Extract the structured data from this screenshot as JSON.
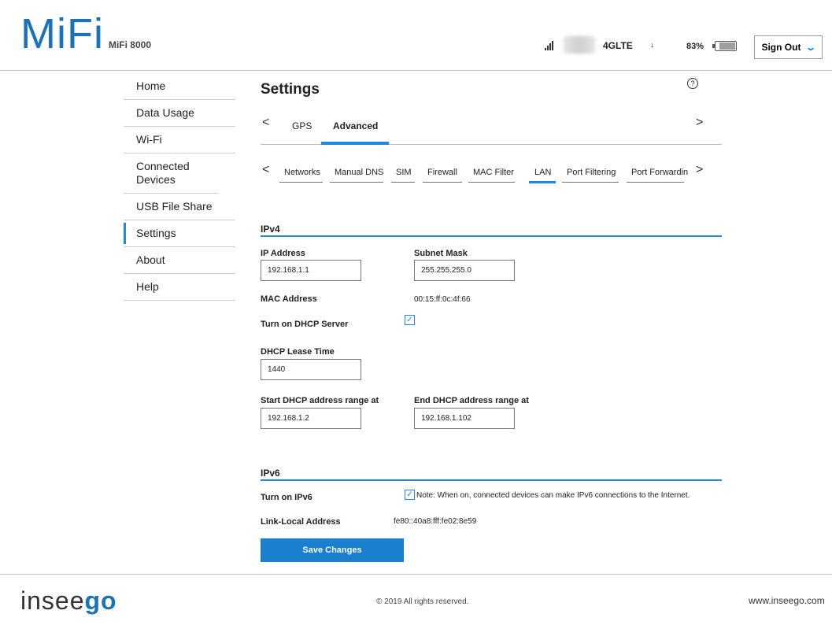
{
  "header": {
    "logo": "MiFi",
    "model": "MiFi 8000",
    "network": "4GLTE",
    "data_arrow": "↓",
    "battery_pct": "83%",
    "battery_level": 0.83,
    "sign_out": "Sign Out"
  },
  "sidebar": {
    "items": [
      {
        "label": "Home"
      },
      {
        "label": "Data Usage"
      },
      {
        "label": "Wi-Fi"
      },
      {
        "label": "Connected Devices"
      },
      {
        "label": "USB File Share"
      },
      {
        "label": "Settings"
      },
      {
        "label": "About"
      },
      {
        "label": "Help"
      }
    ],
    "active": "Settings"
  },
  "main": {
    "title": "Settings",
    "help": "?",
    "tabs_left_arrow": "<",
    "tabs_right_arrow": ">",
    "tabs": [
      "GPS",
      "Advanced"
    ],
    "active_tab": "Advanced",
    "subtabs": [
      "Networks",
      "Manual DNS",
      "SIM",
      "Firewall",
      "MAC Filter",
      "LAN",
      "Port Filtering",
      "Port Forwardin"
    ],
    "active_subtab": "LAN",
    "ipv4": {
      "title": "IPv4",
      "ip_address_label": "IP Address",
      "ip_address": "192.168.1.1",
      "subnet_label": "Subnet Mask",
      "subnet": "255.255.255.0",
      "mac_label": "MAC Address",
      "mac": "00:15:ff:0c:4f:66",
      "dhcp_label": "Turn on DHCP Server",
      "dhcp_checked": true,
      "lease_label": "DHCP Lease Time",
      "lease": "1440",
      "start_label": "Start DHCP address range at",
      "start": "192.168.1.2",
      "end_label": "End DHCP address range at",
      "end": "192.168.1.102"
    },
    "ipv6": {
      "title": "IPv6",
      "turn_on_label": "Turn on IPv6",
      "checked": true,
      "note": "Note: When on, connected devices can make IPv6 connections to the Internet.",
      "link_local_label": "Link-Local Address",
      "link_local": "fe80::40a8:fff:fe02:8e59"
    },
    "save_label": "Save Changes"
  },
  "footer": {
    "brand_light": "insee",
    "brand_bold": "go",
    "copyright": "© 2019 All rights reserved.",
    "url": "www.inseego.com"
  },
  "colors": {
    "accent": "#1e88e5",
    "brand": "#1a73b8",
    "button": "#1a7fcf"
  }
}
